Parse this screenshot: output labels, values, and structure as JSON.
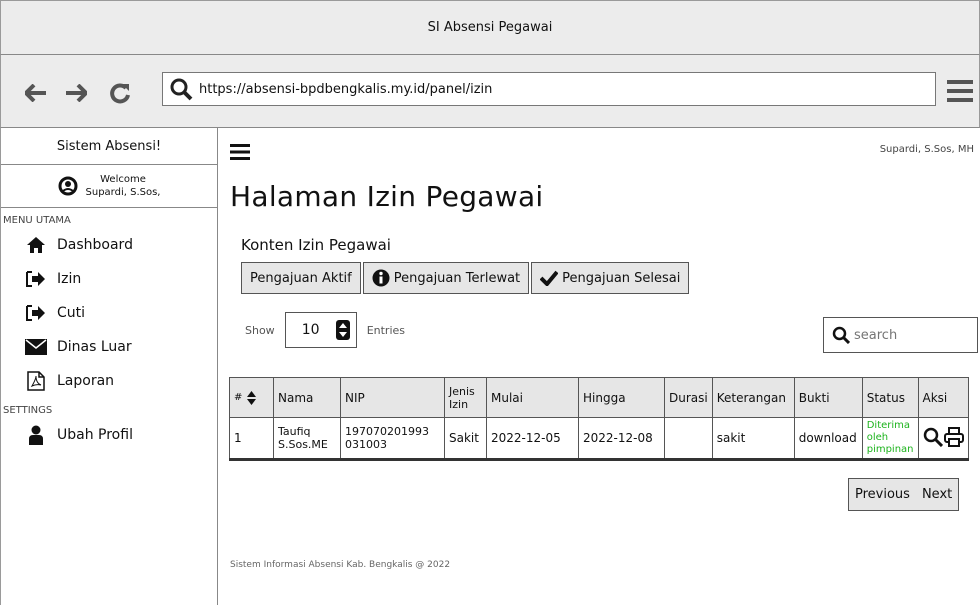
{
  "window": {
    "title": "SI Absensi Pegawai"
  },
  "browser": {
    "back_icon": "arrow-left-icon",
    "forward_icon": "arrow-right-icon",
    "reload_icon": "refresh-icon",
    "url": "https://absensi-bpdbengkalis.my.id/panel/izin",
    "menu_icon": "hamburger-icon"
  },
  "sidebar": {
    "brand": "Sistem Absensi!",
    "welcome": "Welcome",
    "user": "Supardi, S.Sos,",
    "section_main": "MENU UTAMA",
    "section_settings": "SETTINGS",
    "items": [
      {
        "label": "Dashboard",
        "icon": "home-icon"
      },
      {
        "label": "Izin",
        "icon": "sign-in-icon"
      },
      {
        "label": "Cuti",
        "icon": "sign-in-icon"
      },
      {
        "label": "Dinas Luar",
        "icon": "envelope-icon"
      },
      {
        "label": "Laporan",
        "icon": "pdf-file-icon"
      }
    ],
    "settings_items": [
      {
        "label": "Ubah Profil",
        "icon": "user-icon"
      }
    ]
  },
  "header": {
    "user": "Supardi, S.Sos, MH"
  },
  "main": {
    "title": "Halaman Izin Pegawai",
    "subtitle": "Konten Izin Pegawai",
    "tabs": [
      {
        "label": "Pengajuan Aktif"
      },
      {
        "label": "Pengajuan Terlewat",
        "icon": "info-icon"
      },
      {
        "label": "Pengajuan Selesai",
        "icon": "check-icon"
      }
    ],
    "show_label": "Show",
    "entries_value": "10",
    "entries_label": "Entries",
    "search_placeholder": "search"
  },
  "table": {
    "columns": [
      "#",
      "Nama",
      "NIP",
      "Jenis Izin",
      "Mulai",
      "Hingga",
      "Durasi",
      "Keterangan",
      "Bukti",
      "Status",
      "Aksi"
    ],
    "rows": [
      {
        "no": "1",
        "nama": "Taufiq S.Sos.ME",
        "nip": "197070201993 031003",
        "jenis": "Sakit",
        "mulai": "2022-12-05",
        "hingga": "2022-12-08",
        "durasi": "",
        "keterangan": "sakit",
        "bukti": "download",
        "status": "Diterima oleh pimpinan"
      }
    ]
  },
  "pagination": {
    "previous": "Previous",
    "next": "Next"
  },
  "footer": {
    "text": "Sistem Informasi Absensi Kab. Bengkalis @ 2022"
  }
}
